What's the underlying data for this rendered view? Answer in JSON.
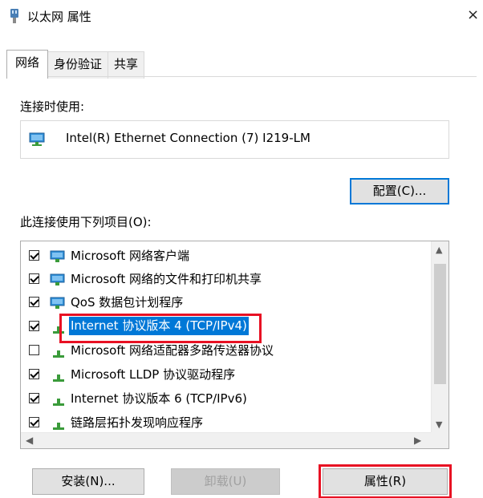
{
  "window": {
    "title": "以太网 属性",
    "close_glyph": "×"
  },
  "tabs": [
    {
      "label": "网络",
      "active": true
    },
    {
      "label": "身份验证",
      "active": false
    },
    {
      "label": "共享",
      "active": false
    }
  ],
  "connect_using_label": "连接时使用:",
  "adapter": {
    "name": "Intel(R) Ethernet Connection (7) I219-LM",
    "icon": "network-adapter-icon"
  },
  "configure_button": "配置(C)...",
  "items_label": "此连接使用下列项目(O):",
  "items": [
    {
      "label": "Microsoft 网络客户端",
      "checked": true,
      "icon": "network-client-icon"
    },
    {
      "label": "Microsoft 网络的文件和打印机共享",
      "checked": true,
      "icon": "network-client-icon"
    },
    {
      "label": "QoS 数据包计划程序",
      "checked": true,
      "icon": "network-client-icon"
    },
    {
      "label": "Internet 协议版本 4 (TCP/IPv4)",
      "checked": true,
      "selected": true,
      "icon": "protocol-icon"
    },
    {
      "label": "Microsoft 网络适配器多路传送器协议",
      "checked": false,
      "icon": "protocol-icon"
    },
    {
      "label": "Microsoft LLDP 协议驱动程序",
      "checked": true,
      "icon": "protocol-icon"
    },
    {
      "label": "Internet 协议版本 6 (TCP/IPv6)",
      "checked": true,
      "icon": "protocol-icon"
    },
    {
      "label": "链路层拓扑发现响应程序",
      "checked": true,
      "icon": "protocol-icon"
    }
  ],
  "buttons": {
    "install": "安装(N)...",
    "uninstall": "卸载(U)",
    "properties": "属性(R)"
  },
  "colors": {
    "highlight": "#0078d7",
    "annotation_red": "#e81123"
  }
}
